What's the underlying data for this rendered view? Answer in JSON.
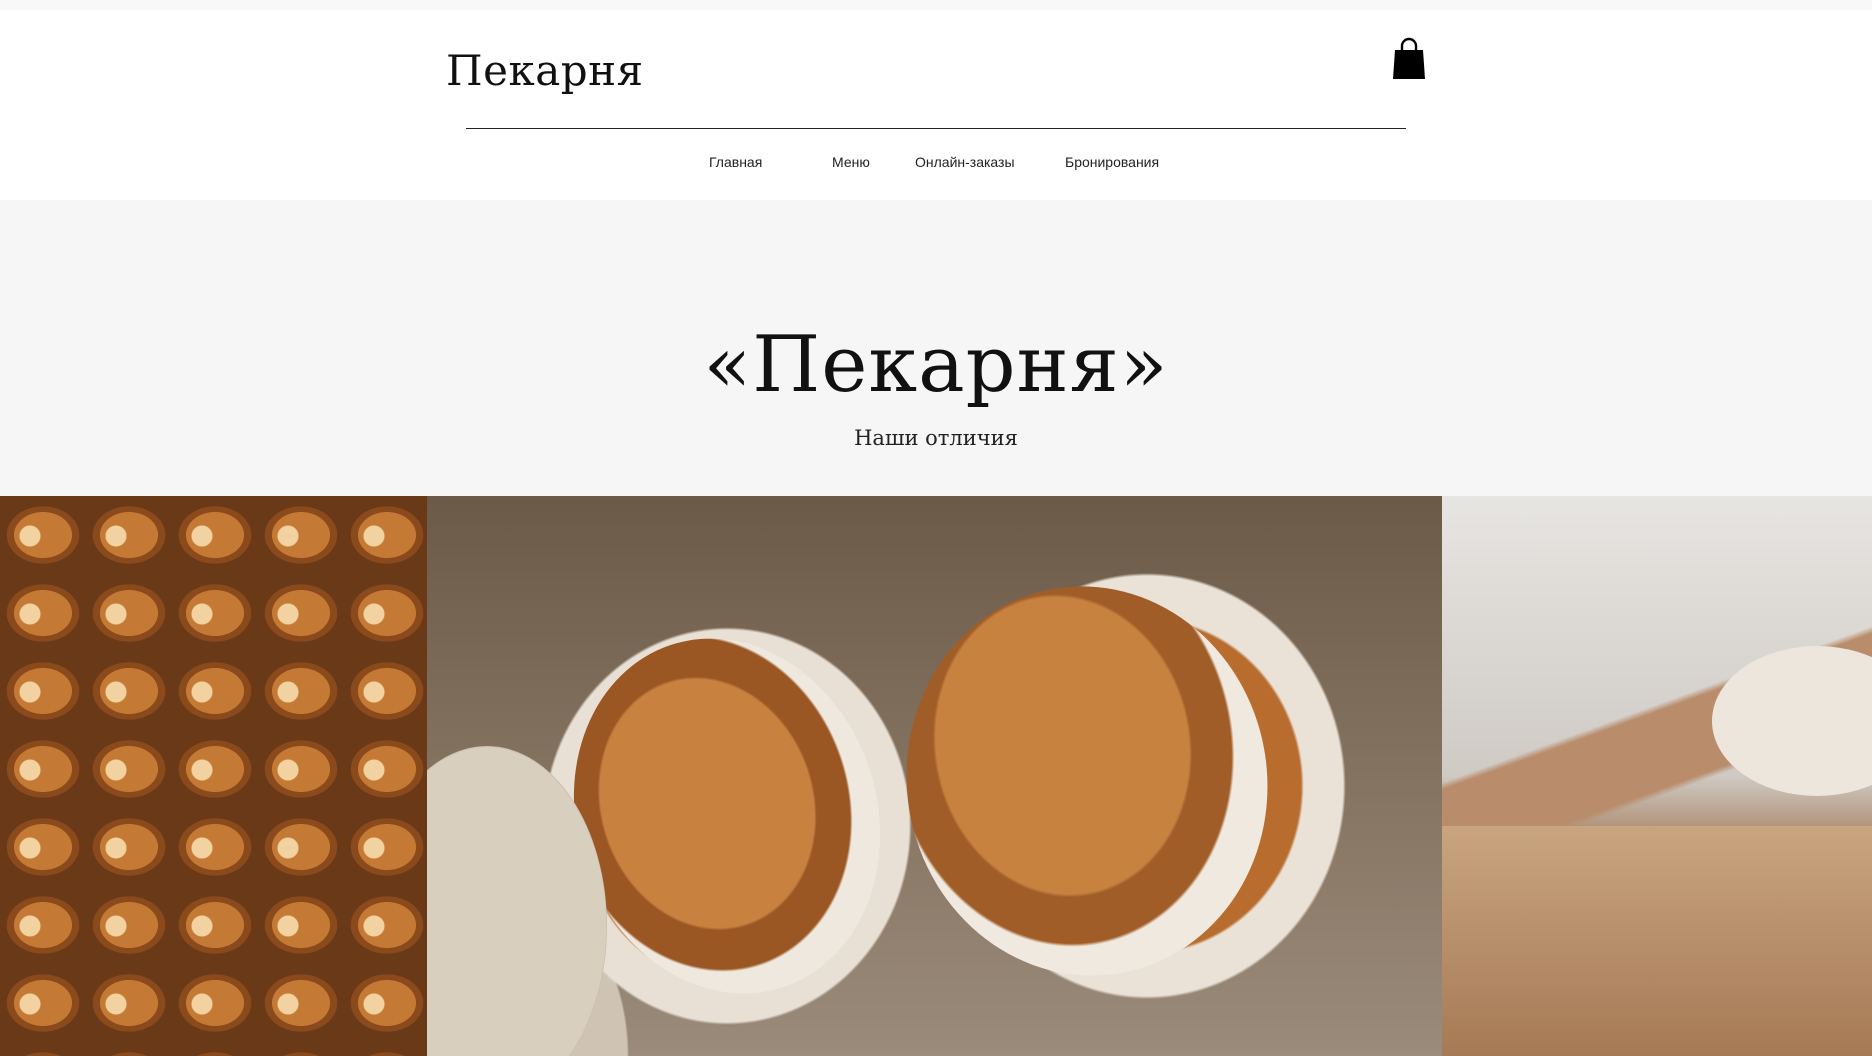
{
  "site": {
    "logo": "Пекарня"
  },
  "header": {
    "cart_icon": "shopping-bag-icon",
    "nav": [
      {
        "label": "Главная"
      },
      {
        "label": "Меню"
      },
      {
        "label": "Онлайн-заказы"
      },
      {
        "label": "Бронирования"
      }
    ]
  },
  "hero": {
    "title": "«Пекарня»",
    "subtitle": "Наши отличия"
  },
  "gallery": {
    "images": [
      {
        "name": "cinnamon-buns-photo"
      },
      {
        "name": "bread-loaves-photo"
      },
      {
        "name": "baker-dough-photo"
      }
    ]
  },
  "colors": {
    "hero_bg": "#f6f6f6",
    "text": "#111111"
  }
}
